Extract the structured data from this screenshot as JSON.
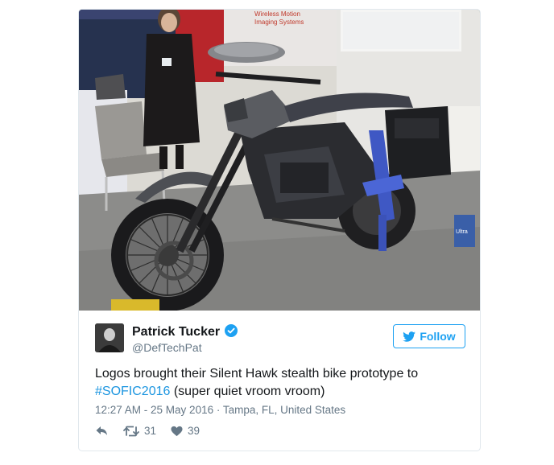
{
  "tweet": {
    "author_name": "Patrick Tucker",
    "author_handle": "@DefTechPat",
    "follow_label": "Follow",
    "text_before": "Logos brought their Silent Hawk stealth bike prototype to ",
    "hashtag": "#SOFIC2016",
    "text_after": " (super quiet vroom vroom)",
    "timestamp": "12:27 AM - 25 May 2016",
    "separator": " · ",
    "location": "Tampa, FL, United States",
    "retweets": "31",
    "likes": "39"
  },
  "photo": {
    "booth_sign_line1": "Wireless Motion",
    "booth_sign_line2": "Imaging Systems",
    "box_label": "Ultra"
  },
  "colors": {
    "accent": "#1da1f2",
    "hashtag": "#1b95e0",
    "muted": "#657786",
    "text": "#14171a",
    "border": "#e1e8ed"
  },
  "icons": [
    "verified-badge-icon",
    "twitter-bird-icon",
    "reply-icon",
    "retweet-icon",
    "like-heart-icon"
  ]
}
